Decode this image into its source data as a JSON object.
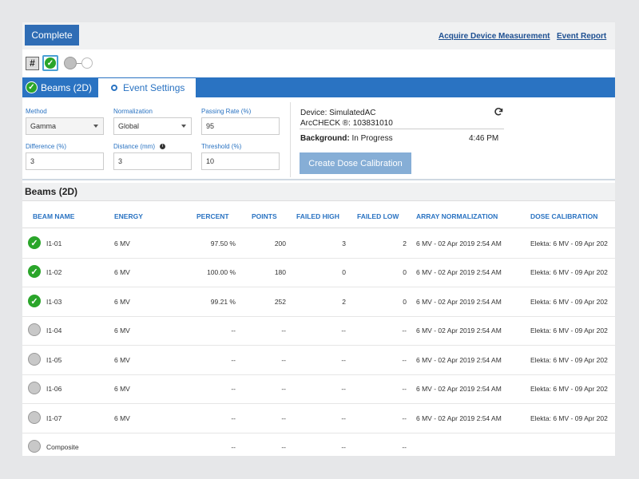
{
  "toolbar": {
    "complete_label": "Complete",
    "acquire_link": "Acquire Device Measurement",
    "report_link": "Event Report"
  },
  "status": {
    "hash_label": "#"
  },
  "tabs": [
    {
      "label": "Beams (2D)",
      "active": true
    },
    {
      "label": "Event Settings",
      "active": false
    }
  ],
  "settings": {
    "method": {
      "label": "Method",
      "value": "Gamma"
    },
    "normalization": {
      "label": "Normalization",
      "value": "Global"
    },
    "passing_rate": {
      "label": "Passing Rate (%)",
      "value": "95"
    },
    "difference": {
      "label": "Difference (%)",
      "value": "3"
    },
    "distance": {
      "label": "Distance (mm)",
      "value": "3"
    },
    "threshold": {
      "label": "Threshold (%)",
      "value": "10"
    }
  },
  "device": {
    "device_line": "Device:  SimulatedAC",
    "serial_line": "ArcCHECK ®: 103831010",
    "background_label": "Background:",
    "background_value": " In Progress",
    "time": "4:46 PM",
    "dose_button": "Create Dose Calibration"
  },
  "section_title": "Beams (2D)",
  "table": {
    "headers": [
      "BEAM NAME",
      "ENERGY",
      "PERCENT",
      "POINTS",
      "FAILED HIGH",
      "FAILED LOW",
      "ARRAY NORMALIZATION",
      "DOSE CALIBRATION"
    ],
    "rows": [
      {
        "status": "pass",
        "name": "I1-01",
        "energy": "6 MV",
        "percent": "97.50 %",
        "points": "200",
        "failed_high": "3",
        "failed_low": "2",
        "array_norm": "6 MV - 02 Apr 2019 2:54 AM",
        "dose_cal": "Elekta: 6 MV - 09 Apr 202"
      },
      {
        "status": "pass",
        "name": "I1-02",
        "energy": "6 MV",
        "percent": "100.00 %",
        "points": "180",
        "failed_high": "0",
        "failed_low": "0",
        "array_norm": "6 MV - 02 Apr 2019 2:54 AM",
        "dose_cal": "Elekta: 6 MV - 09 Apr 202"
      },
      {
        "status": "pass",
        "name": "I1-03",
        "energy": "6 MV",
        "percent": "99.21 %",
        "points": "252",
        "failed_high": "2",
        "failed_low": "0",
        "array_norm": "6 MV - 02 Apr 2019 2:54 AM",
        "dose_cal": "Elekta: 6 MV - 09 Apr 202"
      },
      {
        "status": "pending",
        "name": "I1-04",
        "energy": "6 MV",
        "percent": "--",
        "points": "--",
        "failed_high": "--",
        "failed_low": "--",
        "array_norm": "6 MV - 02 Apr 2019 2:54 AM",
        "dose_cal": "Elekta: 6 MV - 09 Apr 202"
      },
      {
        "status": "pending",
        "name": "I1-05",
        "energy": "6 MV",
        "percent": "--",
        "points": "--",
        "failed_high": "--",
        "failed_low": "--",
        "array_norm": "6 MV - 02 Apr 2019 2:54 AM",
        "dose_cal": "Elekta: 6 MV - 09 Apr 202"
      },
      {
        "status": "pending",
        "name": "I1-06",
        "energy": "6 MV",
        "percent": "--",
        "points": "--",
        "failed_high": "--",
        "failed_low": "--",
        "array_norm": "6 MV - 02 Apr 2019 2:54 AM",
        "dose_cal": "Elekta: 6 MV - 09 Apr 202"
      },
      {
        "status": "pending",
        "name": "I1-07",
        "energy": "6 MV",
        "percent": "--",
        "points": "--",
        "failed_high": "--",
        "failed_low": "--",
        "array_norm": "6 MV - 02 Apr 2019 2:54 AM",
        "dose_cal": "Elekta: 6 MV - 09 Apr 202"
      },
      {
        "status": "pending",
        "name": "Composite",
        "energy": "",
        "percent": "--",
        "points": "--",
        "failed_high": "--",
        "failed_low": "--",
        "array_norm": "",
        "dose_cal": ""
      }
    ]
  },
  "colors": {
    "primary": "#2a73c2",
    "complete_button": "#2f6db5",
    "pass_green": "#2aa52a",
    "pending_gray": "#c8c8c8",
    "link": "#1d4f91"
  }
}
